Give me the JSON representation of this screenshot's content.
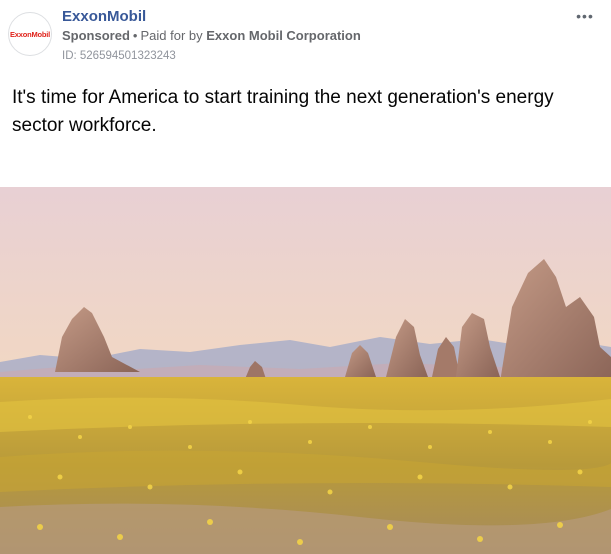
{
  "post": {
    "page_name": "ExxonMobil",
    "avatar_logo_text": "ExxonMobil",
    "sponsored_label": "Sponsored",
    "separator": "•",
    "paid_for_prefix": "Paid for by",
    "payer": "Exxon Mobil Corporation",
    "ad_id": "ID: 526594501323243",
    "more_icon": "ellipsis-icon",
    "more_label": "•••",
    "body_text": "It's time for America to start training the next generation's energy sector workforce."
  },
  "image": {
    "description_icon": "desert-landscape-photo",
    "colors": {
      "sky_top": "#e9d3d6",
      "sky_bottom": "#f6d7a8",
      "mountains": "#9aa4c2",
      "rock": "#a97f70",
      "flowers": "#d8b72c",
      "ground": "#c2a08a"
    }
  }
}
